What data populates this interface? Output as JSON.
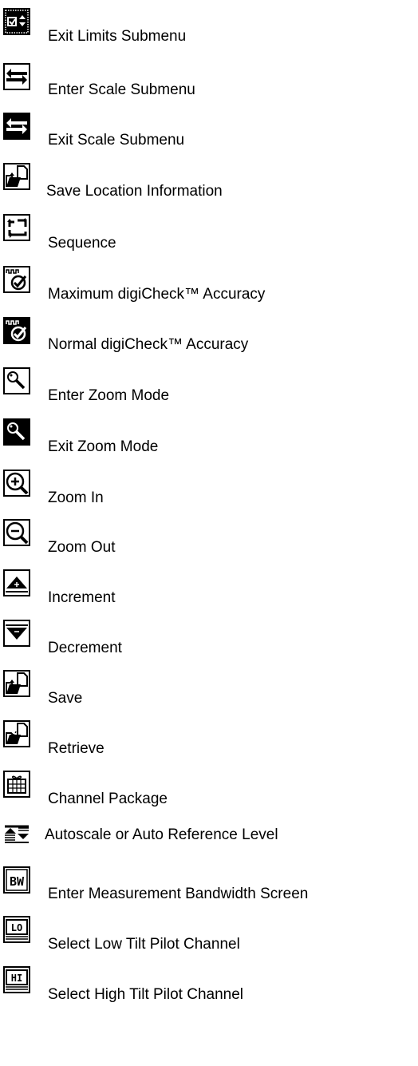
{
  "legend": {
    "items": [
      {
        "icon": "exit-limits-submenu-icon",
        "label": "Exit Limits Submenu"
      },
      {
        "icon": "enter-scale-submenu-icon",
        "label": "Enter Scale Submenu"
      },
      {
        "icon": "exit-scale-submenu-icon",
        "label": "Exit Scale Submenu"
      },
      {
        "icon": "save-location-icon",
        "label": "Save Location Information"
      },
      {
        "icon": "sequence-icon",
        "label": "Sequence"
      },
      {
        "icon": "max-digicheck-icon",
        "label": "Maximum digiCheck™ Accuracy"
      },
      {
        "icon": "normal-digicheck-icon",
        "label": "Normal digiCheck™ Accuracy"
      },
      {
        "icon": "enter-zoom-icon",
        "label": "Enter Zoom Mode"
      },
      {
        "icon": "exit-zoom-icon",
        "label": "Exit Zoom Mode"
      },
      {
        "icon": "zoom-in-icon",
        "label": "Zoom In"
      },
      {
        "icon": "zoom-out-icon",
        "label": "Zoom Out"
      },
      {
        "icon": "increment-icon",
        "label": "Increment"
      },
      {
        "icon": "decrement-icon",
        "label": "Decrement"
      },
      {
        "icon": "save-icon",
        "label": "Save"
      },
      {
        "icon": "retrieve-icon",
        "label": "Retrieve"
      },
      {
        "icon": "channel-package-icon",
        "label": "Channel Package"
      },
      {
        "icon": "autoscale-icon",
        "label": "Autoscale or Auto Reference Level"
      },
      {
        "icon": "bw-icon",
        "label": "Enter Measurement Bandwidth Screen",
        "icon_text": "BW"
      },
      {
        "icon": "lo-icon",
        "label": "Select Low Tilt Pilot Channel",
        "icon_text": "LO"
      },
      {
        "icon": "hi-icon",
        "label": "Select High Tilt Pilot Channel",
        "icon_text": "HI"
      }
    ]
  }
}
